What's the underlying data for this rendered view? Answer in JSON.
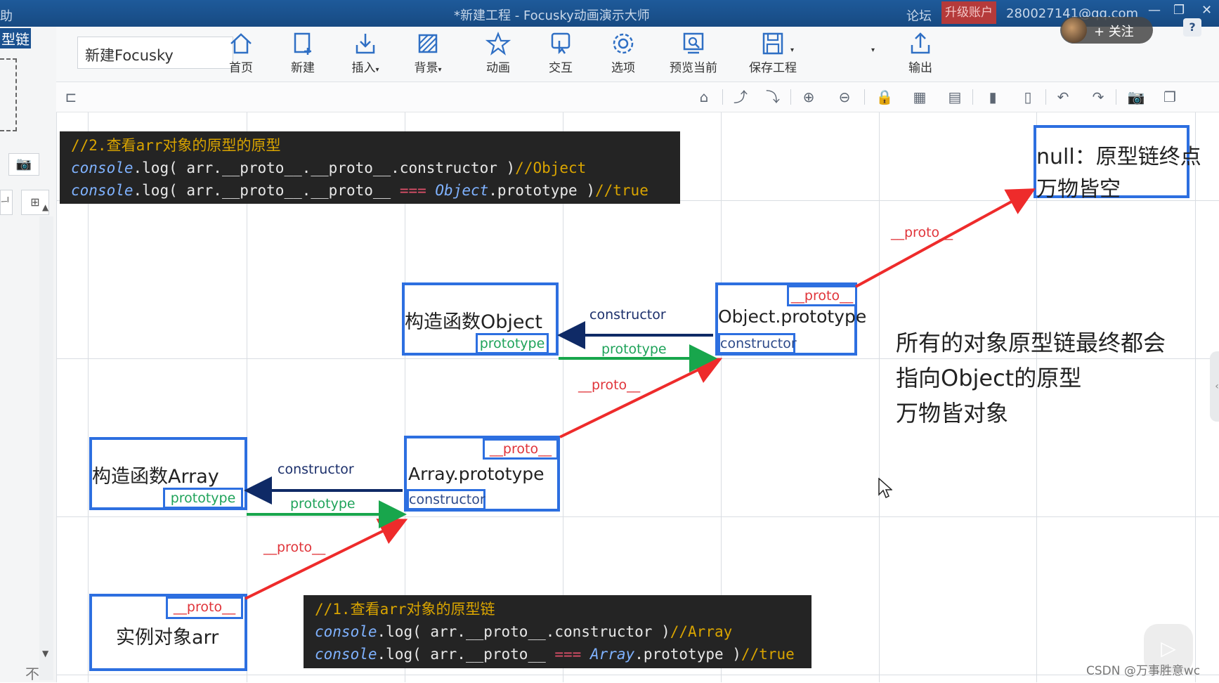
{
  "titlebar": {
    "left_text": "助",
    "title": "*新建工程 - Focusky动画演示大师",
    "forum": "论坛",
    "upgrade": "升级账户",
    "email": "280027141@qq.com",
    "min": "—",
    "restore": "❐",
    "close": "✕"
  },
  "left": {
    "label": "型链",
    "camera": "📷",
    "icon_a": "ᅴ",
    "icon_b": "⊞",
    "arrow_up": "▲",
    "arrow_down": "▼",
    "bottom": "不"
  },
  "toolbar": {
    "project_name": "新建Focusky",
    "buttons": [
      {
        "label": "首页"
      },
      {
        "label": "新建"
      },
      {
        "label": "插入"
      },
      {
        "label": "背景"
      },
      {
        "label": "动画"
      },
      {
        "label": "交互"
      },
      {
        "label": "选项"
      },
      {
        "label": "预览当前"
      },
      {
        "label": "保存工程"
      },
      {
        "label": "输出"
      }
    ]
  },
  "subbar": {
    "icons": [
      "⌂",
      "⤴",
      "⤵",
      "⊕",
      "⊖",
      "🔒",
      "▦",
      "▤",
      "▮",
      "▯",
      "↶",
      "↷",
      "📷",
      "❐"
    ]
  },
  "overlay": {
    "follow": "+ 关注",
    "help": "?",
    "watermark": "CSDN @万事胜意wc",
    "side_tab": "‹",
    "play": "▷"
  },
  "diagram": {
    "code_top": {
      "comment": "//2.查看arr对象的原型的原型",
      "line1": {
        "kw": "console",
        "rest": ".log( arr.__proto__.__proto__.constructor )",
        "result": "//Object"
      },
      "line2": {
        "kw": "console",
        "rest": ".log( arr.__proto__.__proto__ ",
        "eq": "===",
        "kw2": "Object",
        "rest2": ".prototype )",
        "result": "//true"
      }
    },
    "code_bottom": {
      "comment": "//1.查看arr对象的原型链",
      "line1": {
        "kw": "console",
        "rest": ".log( arr.__proto__.constructor )",
        "result": "//Array"
      },
      "line2": {
        "kw": "console",
        "rest": ".log( arr.__proto__ ",
        "eq": "===",
        "kw2": "Array",
        "rest2": ".prototype )",
        "result": "//true"
      }
    },
    "nodes": {
      "null_box": {
        "line1": "null：原型链终点",
        "line2": "万物皆空"
      },
      "object_ctor": {
        "name": "构造函数Object",
        "tag": "prototype"
      },
      "object_proto": {
        "name": "Object.prototype",
        "proto_tag": "__proto__",
        "ctor_tag": "constructor"
      },
      "array_ctor": {
        "name": "构造函数Array",
        "tag": "prototype"
      },
      "array_proto": {
        "name": "Array.prototype",
        "proto_tag": "__proto__",
        "ctor_tag": "constructor"
      },
      "instance": {
        "name": "实例对象arr",
        "proto_tag": "__proto__"
      }
    },
    "labels": {
      "proto_top": "__proto__",
      "proto_mid": "__proto__",
      "proto_low": "__proto__",
      "constructor_top": "constructor",
      "prototype_top": "prototype",
      "constructor_low": "constructor",
      "prototype_low": "prototype"
    },
    "note": {
      "line1": "所有的对象原型链最终都会",
      "line2": "指向Object的原型",
      "line3": "万物皆对象"
    }
  }
}
